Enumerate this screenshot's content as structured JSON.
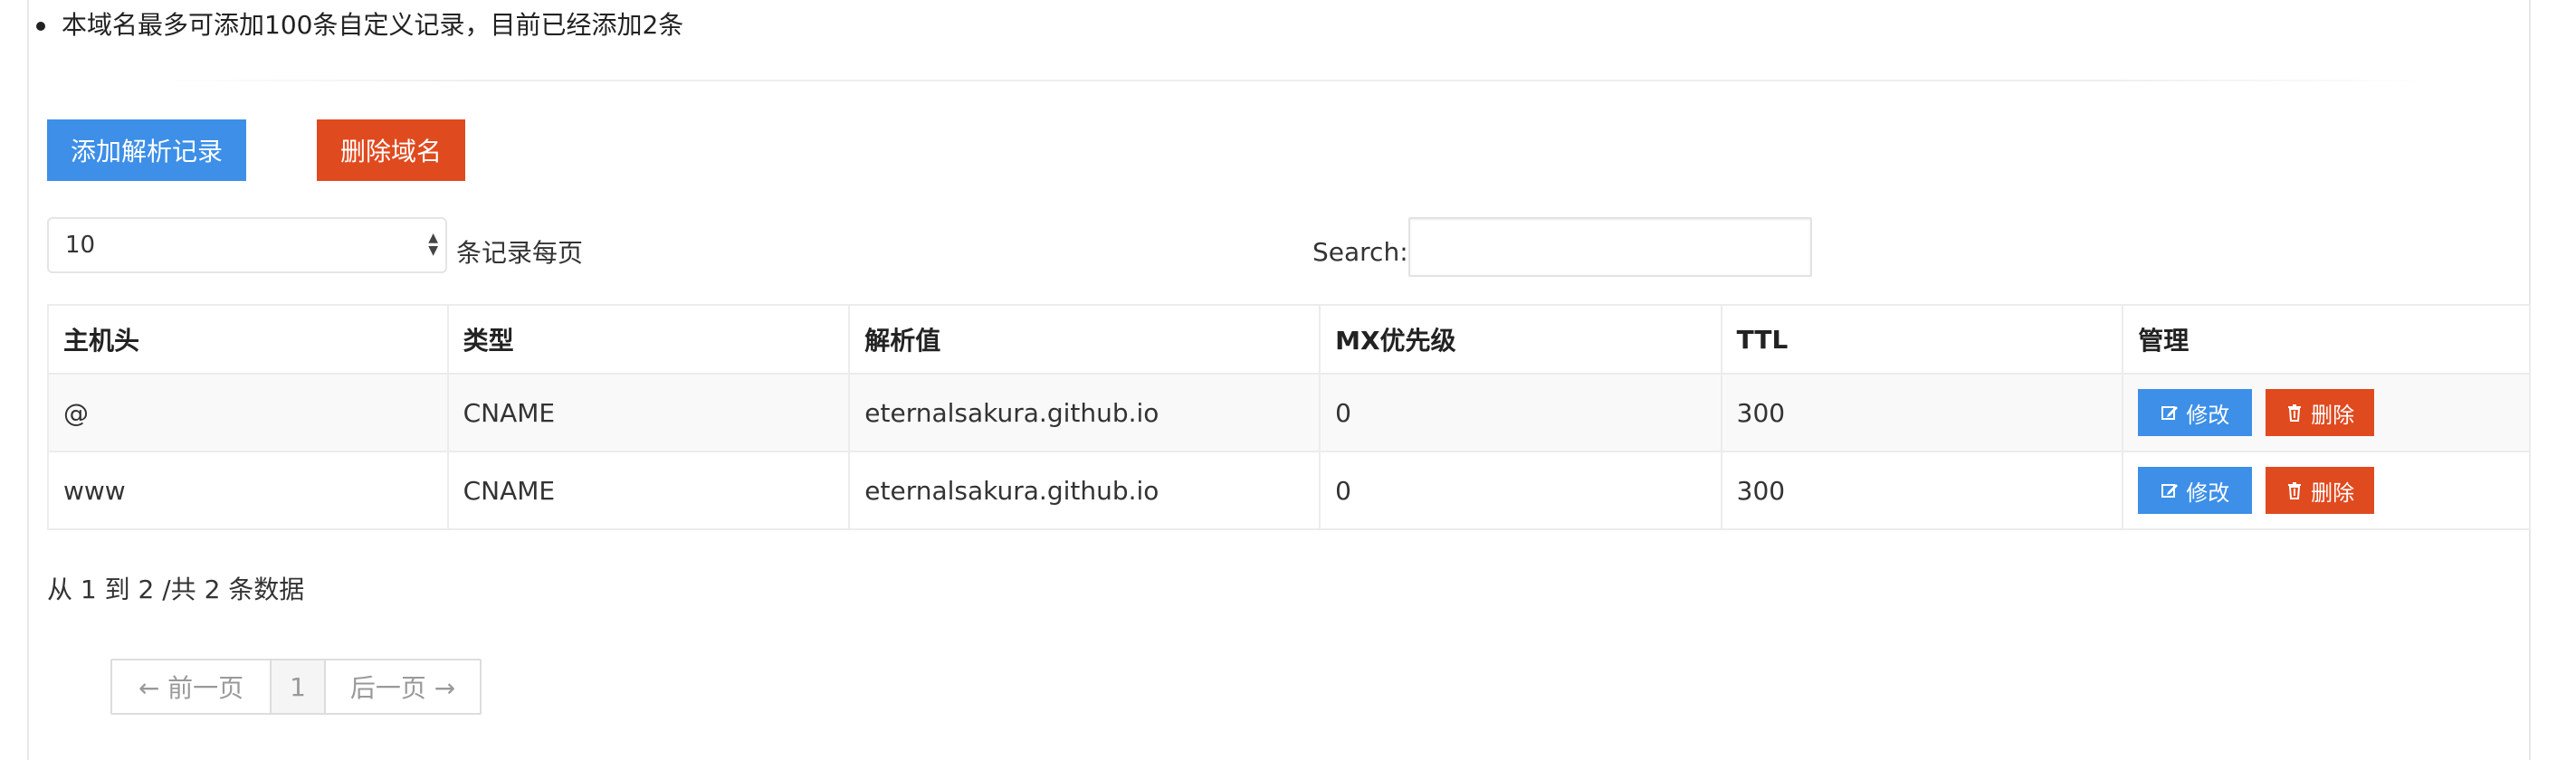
{
  "notice": {
    "domain_limit": "本域名最多可添加100条自定义记录，目前已经添加2条"
  },
  "actions": {
    "add_record": "添加解析记录",
    "delete_domain": "删除域名"
  },
  "length_menu": {
    "selected": "10",
    "label": "条记录每页"
  },
  "search": {
    "label": "Search:",
    "value": ""
  },
  "table": {
    "columns": [
      "主机头",
      "类型",
      "解析值",
      "MX优先级",
      "TTL",
      "管理"
    ],
    "rows": [
      {
        "host": "@",
        "type": "CNAME",
        "value": "eternalsakura.github.io",
        "mx": "0",
        "ttl": "300",
        "edit": "修改",
        "delete": "删除"
      },
      {
        "host": "www",
        "type": "CNAME",
        "value": "eternalsakura.github.io",
        "mx": "0",
        "ttl": "300",
        "edit": "修改",
        "delete": "删除"
      }
    ]
  },
  "info": "从 1 到 2 /共 2 条数据",
  "pagination": {
    "prev": "← 前一页",
    "current": "1",
    "next": "后一页 →"
  },
  "colors": {
    "primary": "#3d8fe8",
    "danger": "#e04a1f"
  },
  "icons": {
    "edit": "edit-icon",
    "delete": "trash-icon"
  }
}
